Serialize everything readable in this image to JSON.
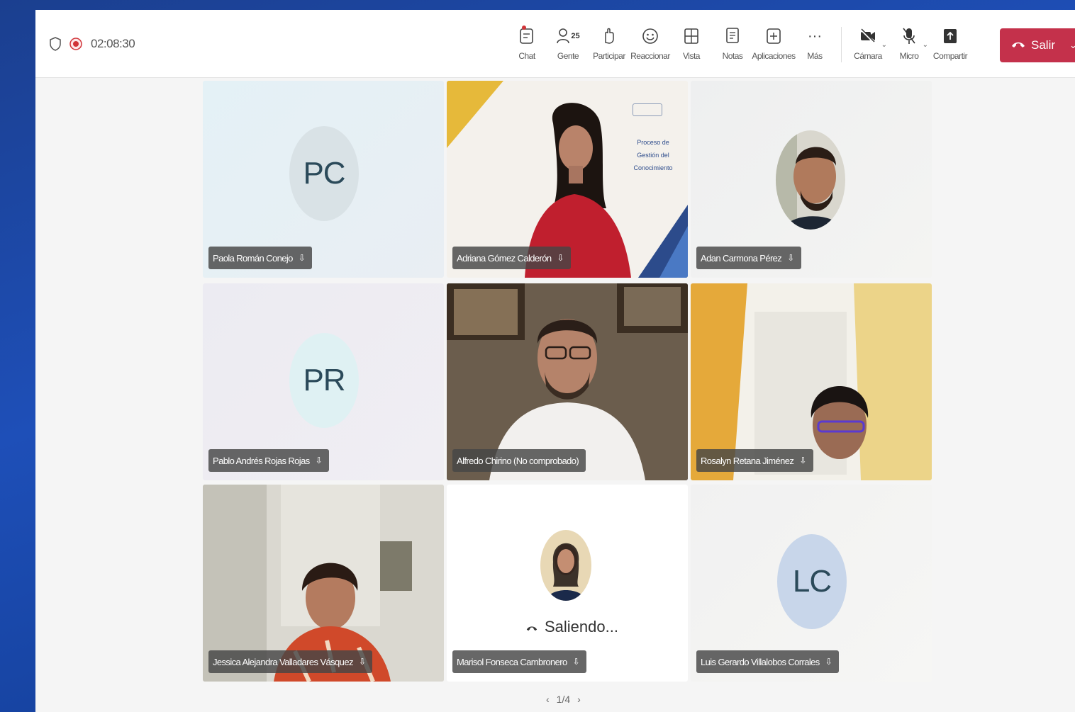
{
  "meeting": {
    "timer": "02:08:30"
  },
  "toolbar": {
    "tools": [
      {
        "name": "chat",
        "label": "Chat"
      },
      {
        "name": "people",
        "label": "Gente",
        "badge": "25"
      },
      {
        "name": "raise-hand",
        "label": "Participar"
      },
      {
        "name": "react",
        "label": "Reaccionar"
      },
      {
        "name": "view",
        "label": "Vista"
      },
      {
        "name": "notes",
        "label": "Notas"
      },
      {
        "name": "apps",
        "label": "Aplicaciones"
      },
      {
        "name": "more",
        "label": "Más"
      }
    ],
    "devices": [
      {
        "name": "camera",
        "label": "Cámara"
      },
      {
        "name": "mic",
        "label": "Micro"
      },
      {
        "name": "share",
        "label": "Compartir"
      }
    ],
    "leave_label": "Salir"
  },
  "participants": [
    {
      "name": "Paola Román Conejo",
      "initials": "PC",
      "type": "initials",
      "avatar_color": "#d9e2e6"
    },
    {
      "name": "Adriana Gómez Calderón",
      "type": "video",
      "slide_lines": [
        "Proceso de",
        "Gestión del",
        "Conocimiento"
      ]
    },
    {
      "name": "Adan Carmona Pérez",
      "type": "photo"
    },
    {
      "name": "Pablo Andrés Rojas Rojas",
      "initials": "PR",
      "type": "initials",
      "avatar_color": "#dff1f3"
    },
    {
      "name": "Alfredo Chirino (No comprobado)",
      "type": "video",
      "active": true
    },
    {
      "name": "Rosalyn Retana Jiménez",
      "type": "video"
    },
    {
      "name": "Jessica Alejandra Valladares Vásquez",
      "type": "video"
    },
    {
      "name": "Marisol Fonseca Cambronero",
      "type": "leaving",
      "status": "Saliendo..."
    },
    {
      "name": "Luis Gerardo Villalobos Corrales",
      "initials": "LC",
      "type": "initials",
      "avatar_color": "#c8d6ea"
    }
  ],
  "pager": {
    "label": "1/4",
    "prev": "‹",
    "next": "›"
  }
}
